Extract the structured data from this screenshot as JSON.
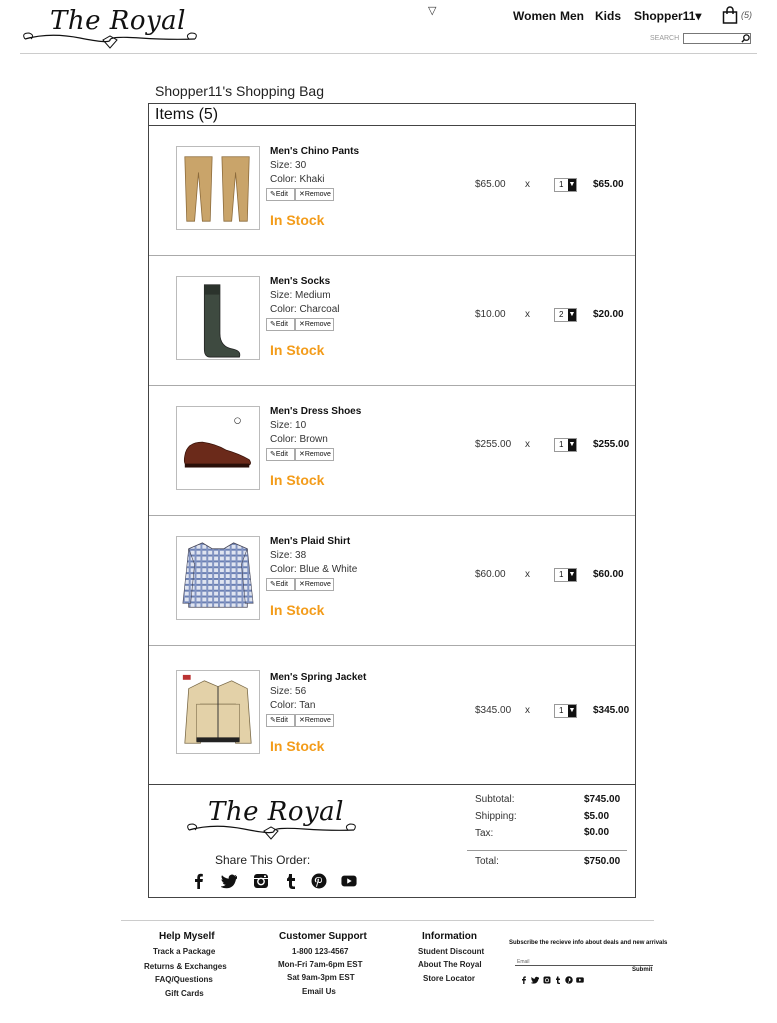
{
  "header": {
    "logo_text": "The Royal",
    "nav": {
      "women": "Women",
      "men": "Men",
      "kids": "Kids",
      "account": "Shopper11▾"
    },
    "bag_count": "(5)",
    "search_label": "SEARCH",
    "search_value": ""
  },
  "bag": {
    "title": "Shopper11's Shopping Bag",
    "items_header": "Items (5)",
    "edit_label": "Edit",
    "remove_label": "Remove",
    "times": "x",
    "items": [
      {
        "name": "Men's Chino Pants",
        "size": "Size: 30",
        "color": "Color: Khaki",
        "stock": "In Stock",
        "price": "$65.00",
        "qty": "1",
        "total": "$65.00"
      },
      {
        "name": "Men's Socks",
        "size": "Size: Medium",
        "color": "Color: Charcoal",
        "stock": "In Stock",
        "price": "$10.00",
        "qty": "2",
        "total": "$20.00"
      },
      {
        "name": "Men's Dress Shoes",
        "size": "Size: 10",
        "color": "Color: Brown",
        "stock": "In Stock",
        "price": "$255.00",
        "qty": "1",
        "total": "$255.00"
      },
      {
        "name": "Men's Plaid Shirt",
        "size": "Size: 38",
        "color": "Color: Blue & White",
        "stock": "In Stock",
        "price": "$60.00",
        "qty": "1",
        "total": "$60.00"
      },
      {
        "name": "Men's Spring Jacket",
        "size": "Size: 56",
        "color": "Color: Tan",
        "stock": "In Stock",
        "price": "$345.00",
        "qty": "1",
        "total": "$345.00"
      }
    ]
  },
  "summary": {
    "logo_text": "The Royal",
    "share_label": "Share This Order:",
    "subtotal_label": "Subtotal:",
    "subtotal": "$745.00",
    "shipping_label": "Shipping:",
    "shipping": "$5.00",
    "tax_label": "Tax:",
    "tax": "$0.00",
    "total_label": "Total:",
    "total": "$750.00"
  },
  "footer": {
    "help": {
      "title": "Help Myself",
      "items": [
        "Track a Package",
        "Returns & Exchanges",
        "FAQ/Questions",
        "Gift Cards"
      ]
    },
    "support": {
      "title": "Customer Support",
      "items": [
        "1-800 123-4567",
        "Mon-Fri 7am-6pm EST",
        "Sat 9am-3pm EST",
        "Email Us"
      ]
    },
    "info": {
      "title": "Information",
      "items": [
        "Student Discount",
        "About The Royal",
        "Store Locator"
      ]
    },
    "subscribe_text": "Subscribe the recieve info about deals and new arrivals",
    "email_label": "Email",
    "submit_label": "Submit"
  },
  "colors": {
    "stock": "#f39c1a",
    "text": "#111111",
    "border": "#444444"
  },
  "icons": [
    "dropdown-triangle",
    "shopping-bag-icon",
    "search-icon",
    "pencil-icon",
    "x-icon",
    "facebook-icon",
    "twitter-icon",
    "instagram-icon",
    "tumblr-icon",
    "pinterest-icon",
    "youtube-icon"
  ]
}
